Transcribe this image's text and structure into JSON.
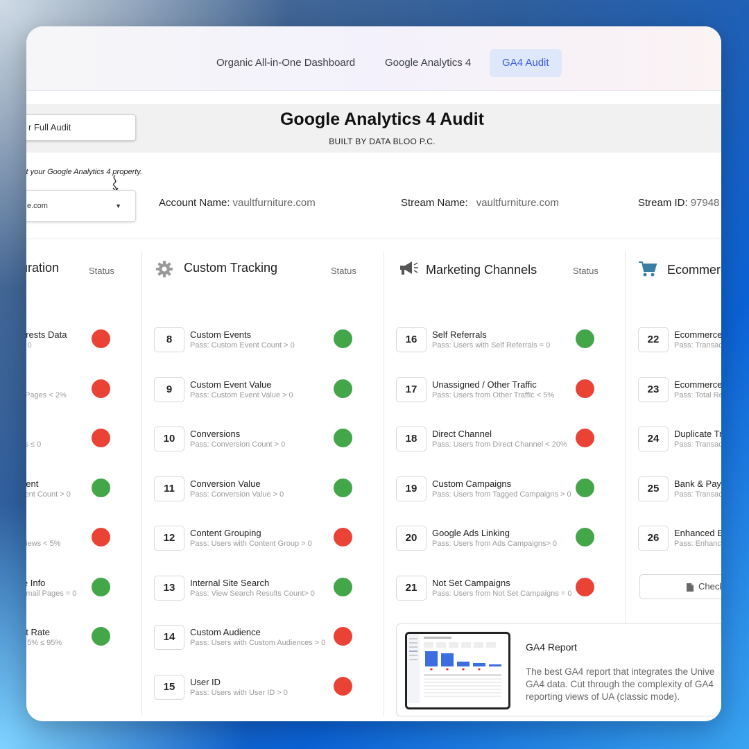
{
  "nav": {
    "tabs": [
      {
        "label": "Organic All-in-One Dashboard"
      },
      {
        "label": "Google Analytics 4"
      },
      {
        "label": "GA4 Audit"
      }
    ]
  },
  "header": {
    "full_audit_label": "r Full Audit",
    "title": "Google Analytics 4 Audit",
    "subtitle": "BUILT BY DATA BLOO P.C."
  },
  "property": {
    "hint": "ct your Google Analytics 4 property.",
    "value": "e.com",
    "account_label": "Account Name:",
    "account_value": "vaultfurniture.com",
    "stream_label": "Stream Name:",
    "stream_value": "vaultfurniture.com",
    "stream_id_label": "Stream ID:",
    "stream_id_value": "97948"
  },
  "columns": [
    {
      "title": "uration",
      "status_label": "Status",
      "icon": "none"
    },
    {
      "title": "Custom Tracking",
      "status_label": "Status",
      "icon": "gear-icon"
    },
    {
      "title": "Marketing Channels",
      "status_label": "Status",
      "icon": "megaphone-icon"
    },
    {
      "title": "Ecommerce",
      "status_label": "",
      "icon": "cart-icon"
    }
  ],
  "col1_rows": [
    {
      "title": "erests Data",
      "sub": "> 0",
      "status": "red"
    },
    {
      "title": "",
      "sub": "t Pages < 2%",
      "status": "red"
    },
    {
      "title": "",
      "sub": "vs ≤ 0",
      "status": "red"
    },
    {
      "title": "nent",
      "sub": "vent Count > 0",
      "status": "green"
    },
    {
      "title": "",
      "sub": "Views < 5%",
      "status": "red"
    },
    {
      "title": "le Info",
      "sub": "Email Pages = 0",
      "status": "green"
    },
    {
      "title": "nt Rate",
      "sub": "≥ 5%  ≤ 95%",
      "status": "green"
    }
  ],
  "col2_rows": [
    {
      "num": "8",
      "title": "Custom Events",
      "sub": "Pass: Custom Event Count > 0",
      "status": "green"
    },
    {
      "num": "9",
      "title": "Custom Event Value",
      "sub": "Pass: Custom Event Value > 0",
      "status": "green"
    },
    {
      "num": "10",
      "title": "Conversions",
      "sub": "Pass: Conversion Count > 0",
      "status": "green"
    },
    {
      "num": "11",
      "title": "Conversion Value",
      "sub": "Pass: Conversion Value > 0",
      "status": "green"
    },
    {
      "num": "12",
      "title": "Content Grouping",
      "sub": "Pass: Users with Content Group > 0",
      "status": "red"
    },
    {
      "num": "13",
      "title": "Internal Site Search",
      "sub": "Pass: View Search Results Count> 0",
      "status": "green"
    },
    {
      "num": "14",
      "title": "Custom Audience",
      "sub": "Pass: Users with Custom Audiences > 0",
      "status": "red"
    },
    {
      "num": "15",
      "title": "User ID",
      "sub": "Pass: Users with User ID > 0",
      "status": "red"
    }
  ],
  "col3_rows": [
    {
      "num": "16",
      "title": "Self Referrals",
      "sub": "Pass: Users with Self Referrals = 0",
      "status": "green"
    },
    {
      "num": "17",
      "title": "Unassigned / Other Traffic",
      "sub": "Pass: Users from Other Traffic < 5%",
      "status": "red"
    },
    {
      "num": "18",
      "title": "Direct Channel",
      "sub": "Pass: Users from Direct Channel < 20%",
      "status": "red"
    },
    {
      "num": "19",
      "title": "Custom Campaigns",
      "sub": "Pass: Users from Tagged Campaigns > 0",
      "status": "green"
    },
    {
      "num": "20",
      "title": "Google Ads Linking",
      "sub": "Pass: Users from Ads Campaigns> 0",
      "status": "green"
    },
    {
      "num": "21",
      "title": "Not Set Campaigns",
      "sub": "Pass: Users from Not Set Campaigns = 0",
      "status": "red"
    }
  ],
  "col4_rows": [
    {
      "num": "22",
      "title": "Ecommerce T",
      "sub": "Pass: Transacti"
    },
    {
      "num": "23",
      "title": "Ecommerce",
      "sub": "Pass: Total Rev"
    },
    {
      "num": "24",
      "title": "Duplicate Tra",
      "sub": "Pass: Transacti"
    },
    {
      "num": "25",
      "title": "Bank & Paym",
      "sub": "Pass: Transacti"
    },
    {
      "num": "26",
      "title": "Enhanced Ec",
      "sub": "Pass: Enhance"
    }
  ],
  "check_button": "Check",
  "report": {
    "title": "GA4 Report",
    "desc_lines": [
      "The best GA4 report that integrates the Unive",
      "GA4 data. Cut through the complexity of GA4",
      "reporting views of UA (classic mode)."
    ]
  },
  "colors": {
    "green": "#43a649",
    "red": "#ea4335",
    "accent": "#3b5bdb"
  }
}
